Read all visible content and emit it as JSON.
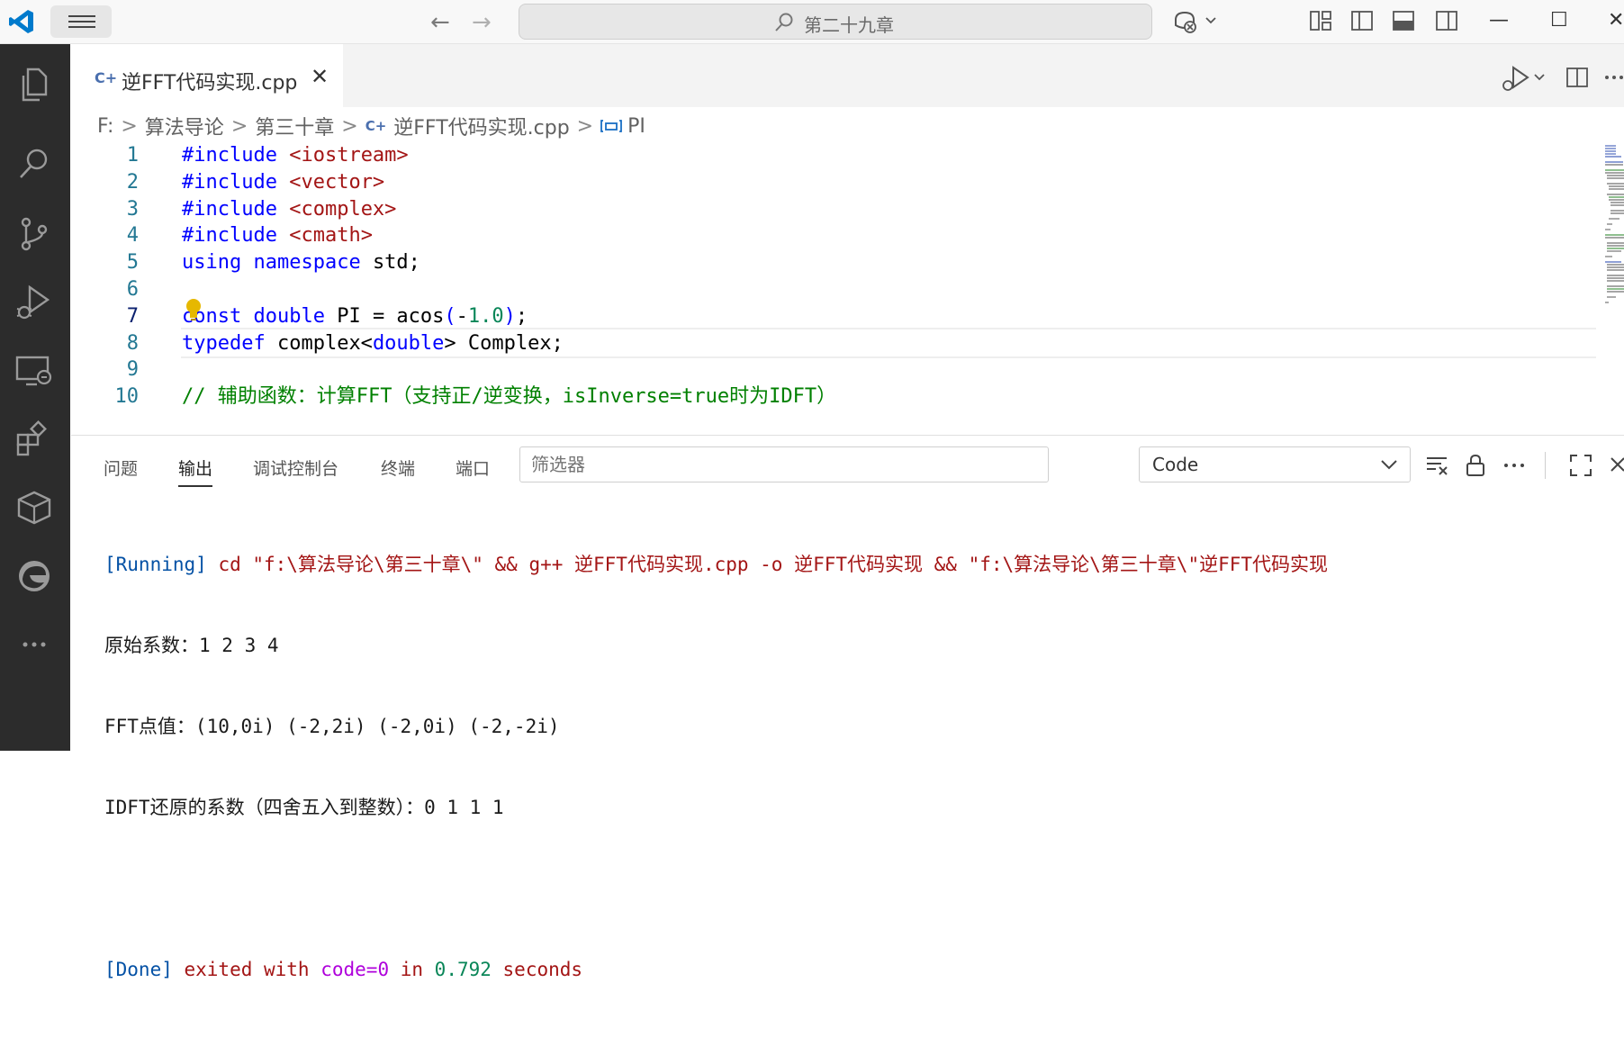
{
  "titlebar": {
    "search_text": "第二十九章",
    "back_glyph": "←",
    "forward_glyph": "→",
    "minimize_glyph": "—",
    "maximize_glyph": "☐",
    "close_glyph": "✕"
  },
  "activity_bar": {
    "items": [
      "explorer-icon",
      "search-icon",
      "source-control-icon",
      "run-debug-icon",
      "remote-explorer-icon",
      "extensions-icon",
      "packages-icon",
      "edge-icon",
      "more-icon"
    ]
  },
  "tab": {
    "icon": "C+",
    "label": "逆FFT代码实现.cpp",
    "close": "✕"
  },
  "breadcrumb": {
    "items": [
      "F:",
      "算法导论",
      "第三十章",
      "逆FFT代码实现.cpp",
      "PI"
    ]
  },
  "editor": {
    "line_numbers": [
      "1",
      "2",
      "3",
      "4",
      "5",
      "6",
      "7",
      "8",
      "9",
      "10"
    ],
    "lines": [
      [
        {
          "t": "#include ",
          "c": "pp"
        },
        {
          "t": "<iostream>",
          "c": "str"
        }
      ],
      [
        {
          "t": "#include ",
          "c": "pp"
        },
        {
          "t": "<vector>",
          "c": "str"
        }
      ],
      [
        {
          "t": "#include ",
          "c": "pp"
        },
        {
          "t": "<complex>",
          "c": "str"
        }
      ],
      [
        {
          "t": "#include ",
          "c": "pp"
        },
        {
          "t": "<cmath>",
          "c": "str"
        }
      ],
      [
        {
          "t": "using ",
          "c": "kw"
        },
        {
          "t": "namespace ",
          "c": "kw"
        },
        {
          "t": "std;",
          "c": ""
        }
      ],
      [],
      [
        {
          "t": "const ",
          "c": "kw"
        },
        {
          "t": "double ",
          "c": "kw"
        },
        {
          "t": "PI = acos",
          "c": ""
        },
        {
          "t": "(",
          "c": "kw"
        },
        {
          "t": "-",
          "c": ""
        },
        {
          "t": "1.0",
          "c": "num"
        },
        {
          "t": ")",
          "c": "kw"
        },
        {
          "t": ";",
          "c": ""
        }
      ],
      [
        {
          "t": "typedef ",
          "c": "kw"
        },
        {
          "t": "complex<",
          "c": ""
        },
        {
          "t": "double",
          "c": "kw"
        },
        {
          "t": "> Complex;",
          "c": ""
        }
      ],
      [],
      [
        {
          "t": "// 辅助函数：计算FFT（支持正/逆变换，isInverse=true时为IDFT）",
          "c": "cmt"
        }
      ]
    ]
  },
  "panel": {
    "tabs": [
      "问题",
      "输出",
      "调试控制台",
      "终端",
      "端口"
    ],
    "active_tab": "输出",
    "filter_placeholder": "筛选器",
    "output_channel": "Code",
    "output": {
      "running_tag": "[Running]",
      "running_cmd": " cd \"f:\\算法导论\\第三十章\\\" && g++ 逆FFT代码实现.cpp -o 逆FFT代码实现 && \"f:\\算法导论\\第三十章\\\"逆FFT代码实现",
      "line2": "原始系数：1 2 3 4",
      "line3": "FFT点值：(10,0i) (-2,2i) (-2,0i) (-2,-2i)",
      "line4": "IDFT还原的系数（四舍五入到整数）：0 1 1 1",
      "done_tag": "[Done]",
      "done_text1": " exited with ",
      "done_code": "code=0",
      "done_text2": " in ",
      "done_time": "0.792",
      "done_text3": " seconds"
    }
  },
  "colors": {
    "activity_bg": "#2c2c2c",
    "accent": "#0078d4",
    "keyword": "#0000ff",
    "string": "#a31515",
    "number": "#098658"
  }
}
